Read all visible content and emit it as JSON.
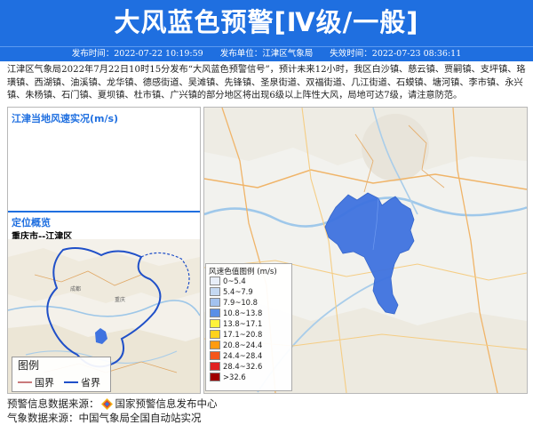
{
  "header": {
    "title": "大风蓝色预警[Ⅳ级/一般]",
    "publish_time": "发布时间：2022-07-22 10:19:59",
    "publisher": "发布单位：江津区气象局",
    "expire_time": "失效时间：2022-07-23 08:36:11"
  },
  "content": {
    "text": "江津区气象局2022年7月22日10时15分发布“大风蓝色预警信号”，预计未来12小时，我区白沙镇、慈云镇、贾嗣镇、支坪镇、珞璜镇、西湖镇、油溪镇、龙华镇、德感街道、吴滩镇、先锋镇、圣泉街道、双福街道、几江街道、石蟆镇、塘河镇、李市镇、永兴镇、朱杨镇、石门镇、夏坝镇、杜市镇、广兴镇的部分地区将出现6级以上阵性大风，局地可达7级，请注意防范。"
  },
  "left_panel": {
    "wind_title": "江津当地风速实况(m/s)",
    "location_title": "定位概览",
    "location_name": "重庆市--江津区",
    "legend": {
      "title": "图例",
      "items": [
        {
          "label": "国界",
          "color": "#c97a7a"
        },
        {
          "label": "省界",
          "color": "#2050c8"
        }
      ]
    }
  },
  "wind_legend": {
    "title": "风速色值图例 (m/s)",
    "items": [
      {
        "label": "0~5.4",
        "color": "#e8eef8"
      },
      {
        "label": "5.4~7.9",
        "color": "#c5d9f3"
      },
      {
        "label": "7.9~10.8",
        "color": "#a3c2ef"
      },
      {
        "label": "10.8~13.8",
        "color": "#5a8fe6"
      },
      {
        "label": "13.8~17.1",
        "color": "#fff23a"
      },
      {
        "label": "17.1~20.8",
        "color": "#ffd21c"
      },
      {
        "label": "20.8~24.4",
        "color": "#ff9b10"
      },
      {
        "label": "24.4~28.4",
        "color": "#f5561a"
      },
      {
        "label": "28.4~32.6",
        "color": "#e02020"
      },
      {
        "label": ">32.6",
        "color": "#a00000"
      }
    ]
  },
  "footer": {
    "source_label": "预警信息数据来源：",
    "source_name": "国家预警信息发布中心",
    "weather_source": "气象数据来源：中国气象局全国自动站实况"
  },
  "colors": {
    "header_bg": "#1f6fe0",
    "region_fill": "#3f73e0"
  }
}
